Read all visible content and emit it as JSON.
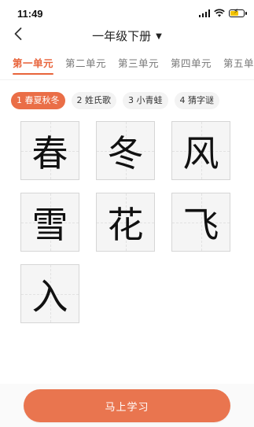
{
  "status_bar": {
    "time": "11:49",
    "icons": [
      "signal-icon",
      "wifi-icon",
      "battery-charging-icon"
    ]
  },
  "nav": {
    "title": "一年级下册",
    "back_icon": "chevron-left-icon",
    "dropdown_icon": "caret-down-icon"
  },
  "tabs": [
    {
      "label": "第一单元",
      "active": true
    },
    {
      "label": "第二单元",
      "active": false
    },
    {
      "label": "第三单元",
      "active": false
    },
    {
      "label": "第四单元",
      "active": false
    },
    {
      "label": "第五单",
      "active": false
    }
  ],
  "lessons": [
    {
      "label": "1 春夏秋冬",
      "active": true
    },
    {
      "label": "2 姓氏歌",
      "active": false
    },
    {
      "label": "3 小青蛙",
      "active": false
    },
    {
      "label": "4 猜字谜",
      "active": false
    }
  ],
  "characters": [
    "春",
    "冬",
    "风",
    "雪",
    "花",
    "飞",
    "入"
  ],
  "action": {
    "label": "马上学习"
  },
  "colors": {
    "accent": "#e8643b",
    "button": "#e9754f"
  }
}
